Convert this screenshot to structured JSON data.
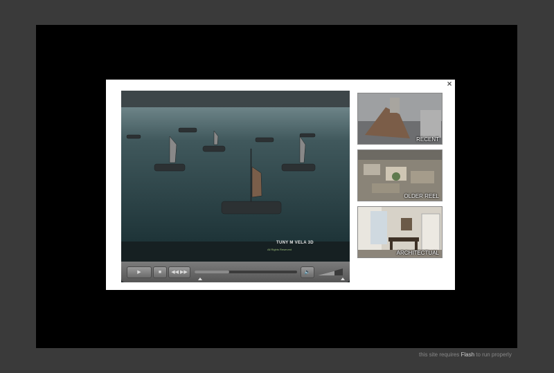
{
  "player": {
    "caption": "TUNY M VELA 3D",
    "caption_sub": "All Rights Reserved",
    "progress": 0.34,
    "controls": {
      "play_icon": "play-icon",
      "stop_icon": "stop-icon",
      "prev_icon": "rewind-icon",
      "next_icon": "fast-forward-icon",
      "volume_icon": "speaker-icon"
    }
  },
  "thumbnails": [
    {
      "label": "RECENT"
    },
    {
      "label": "OLDER REEL"
    },
    {
      "label": "ARCHITECTUAL"
    }
  ],
  "modal": {
    "close_label": "×"
  },
  "footer": {
    "prefix": "this site requires ",
    "highlight": "Flash",
    "suffix": " to run properly"
  },
  "colors": {
    "background": "#3a3a3a",
    "stage": "#000000",
    "modal": "#ffffff"
  }
}
